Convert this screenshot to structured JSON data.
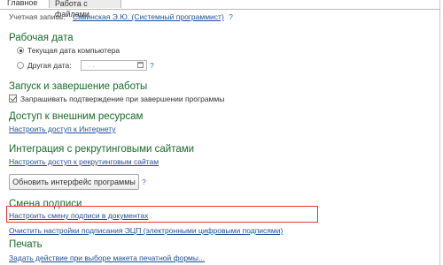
{
  "tabs": [
    {
      "label": "Главное"
    },
    {
      "label": "Работа с файлами"
    }
  ],
  "account": {
    "label": "Учетная запись:",
    "value": "Савинская Э.Ю. (Системный программист)"
  },
  "help_glyph": "?",
  "work_date": {
    "title": "Рабочая дата",
    "option_computer": "Текущая дата компьютера",
    "option_other": "Другая дата:",
    "date_value": ".  .",
    "selected": "computer"
  },
  "startup": {
    "title": "Запуск и завершение работы",
    "checkbox_label": "Запрашивать подтверждение при завершении программы",
    "checked": true
  },
  "external": {
    "title": "Доступ к внешним ресурсам",
    "link": "Настроить доступ к Интернету"
  },
  "recruit": {
    "title": "Интеграция с рекрутинговыми сайтами",
    "link": "Настроить доступ к рекрутинговым сайтам"
  },
  "refresh_button": "Обновить интерфейс программы",
  "signature": {
    "title": "Смена подписи",
    "link": "Настроить смену подписи в документах"
  },
  "ecp_link": "Очистить настройки подписания ЭЦП (электронными цифровыми подписями)",
  "print": {
    "title": "Печать",
    "link": "Задать действие при выборе макета печатной формы..."
  },
  "colors": {
    "section_title": "#1b6b2c",
    "link": "#1f4f98",
    "highlight": "#e23b3b"
  }
}
